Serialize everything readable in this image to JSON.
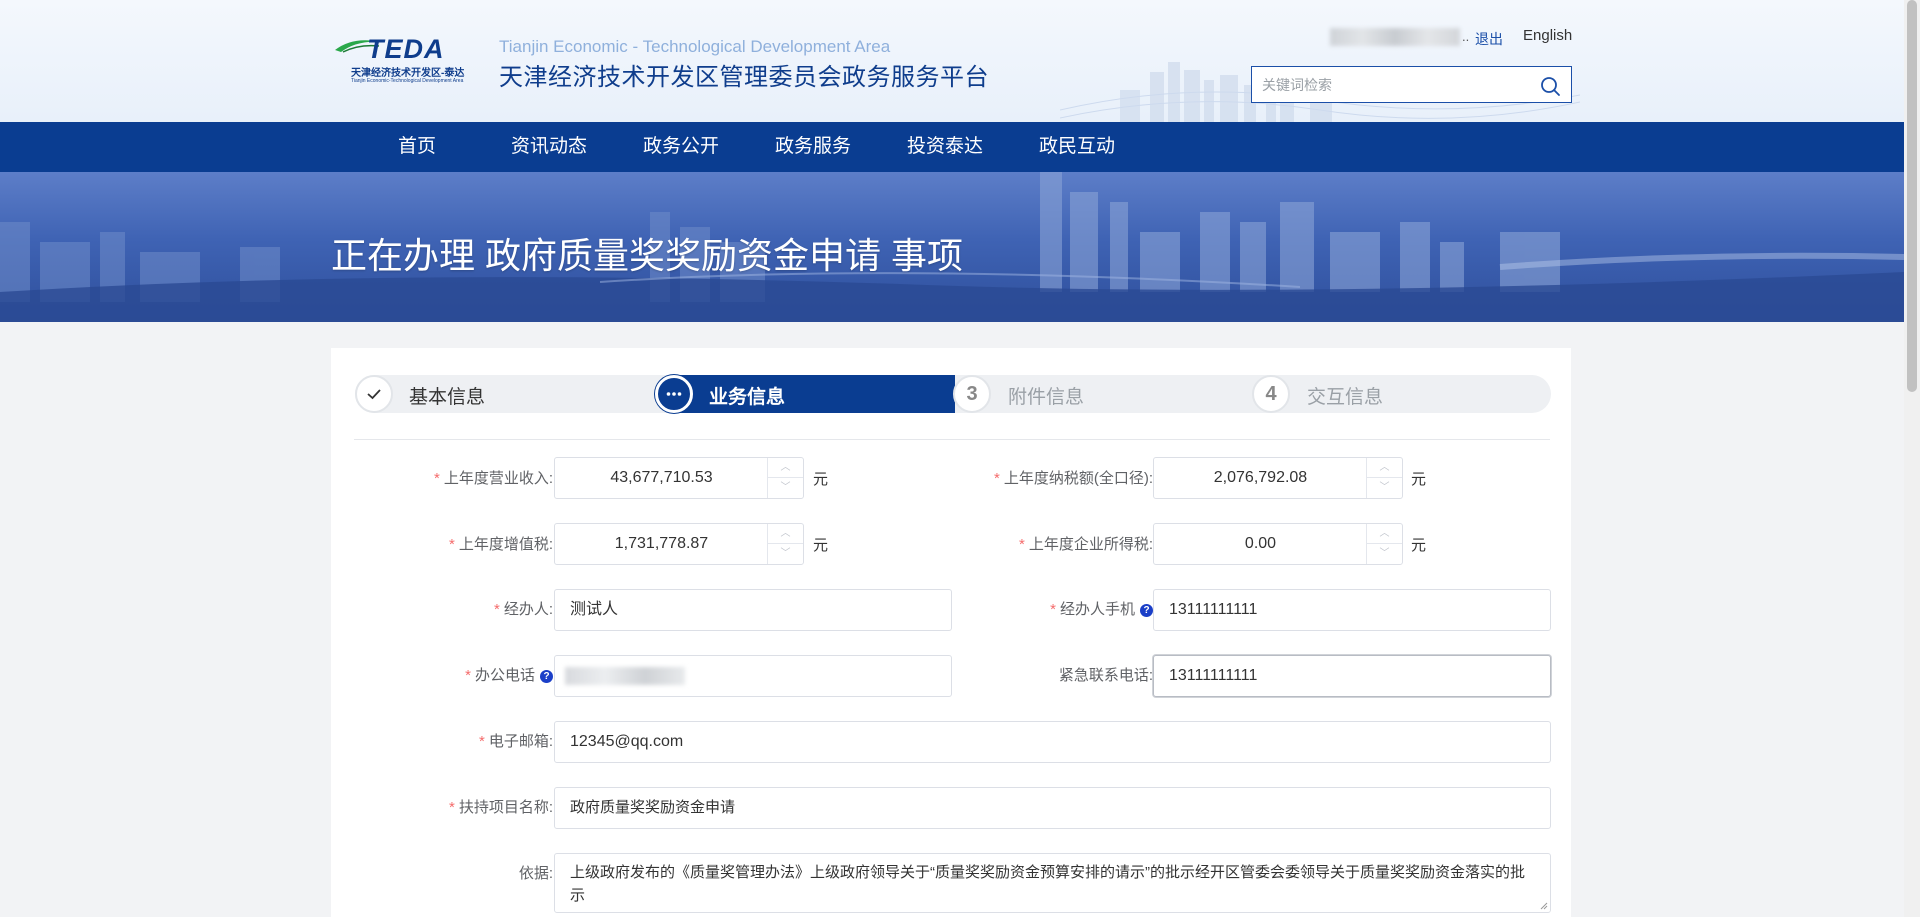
{
  "header": {
    "logo_text": "TEDA",
    "logo_cn": "天津经济技术开发区-泰达",
    "logo_en": "Tianjin Economic-Technological Development Area",
    "site_title_en": "Tianjin Economic - Technological Development Area",
    "site_title_cn": "天津经济技术开发区管理委员会政务服务平台",
    "user_suffix": "..",
    "logout_label": "退出",
    "language_label": "English",
    "search_placeholder": "关键词检索"
  },
  "nav": {
    "items": [
      "首页",
      "资讯动态",
      "政务公开",
      "政务服务",
      "投资泰达",
      "政民互动"
    ]
  },
  "banner": {
    "title": "正在办理 政府质量奖奖励资金申请 事项"
  },
  "steps": [
    {
      "number": "",
      "label": "基本信息",
      "status": "done"
    },
    {
      "number": "",
      "label": "业务信息",
      "status": "active"
    },
    {
      "number": "3",
      "label": "附件信息",
      "status": "pending"
    },
    {
      "number": "4",
      "label": "交互信息",
      "status": "pending"
    }
  ],
  "form": {
    "revenue": {
      "label": "上年度营业收入:",
      "value": "43,677,710.53",
      "unit": "元"
    },
    "tax_total": {
      "label": "上年度纳税额(全口径):",
      "value": "2,076,792.08",
      "unit": "元"
    },
    "vat": {
      "label": "上年度增值税:",
      "value": "1,731,778.87",
      "unit": "元"
    },
    "income_tax": {
      "label": "上年度企业所得税:",
      "value": "0.00",
      "unit": "元"
    },
    "handler": {
      "label": "经办人:",
      "value": "测试人"
    },
    "handler_phone": {
      "label": "经办人手机",
      "value": "13111111111"
    },
    "office_phone": {
      "label": "办公电话"
    },
    "emergency_phone": {
      "label": "紧急联系电话:",
      "value": "13111111111"
    },
    "email": {
      "label": "电子邮箱:",
      "value": "12345@qq.com"
    },
    "project_name": {
      "label": "扶持项目名称:",
      "value": "政府质量奖奖励资金申请"
    },
    "basis": {
      "label": "依据:",
      "value": "上级政府发布的《质量奖管理办法》上级政府领导关于“质量奖奖励资金预算安排的请示”的批示经开区管委会委领导关于质量奖奖励资金落实的批示"
    },
    "required_mark": "*",
    "help_mark": "?"
  },
  "colors": {
    "primary": "#0a3d91",
    "required": "#f56c6c",
    "help": "#1b3fc8"
  }
}
